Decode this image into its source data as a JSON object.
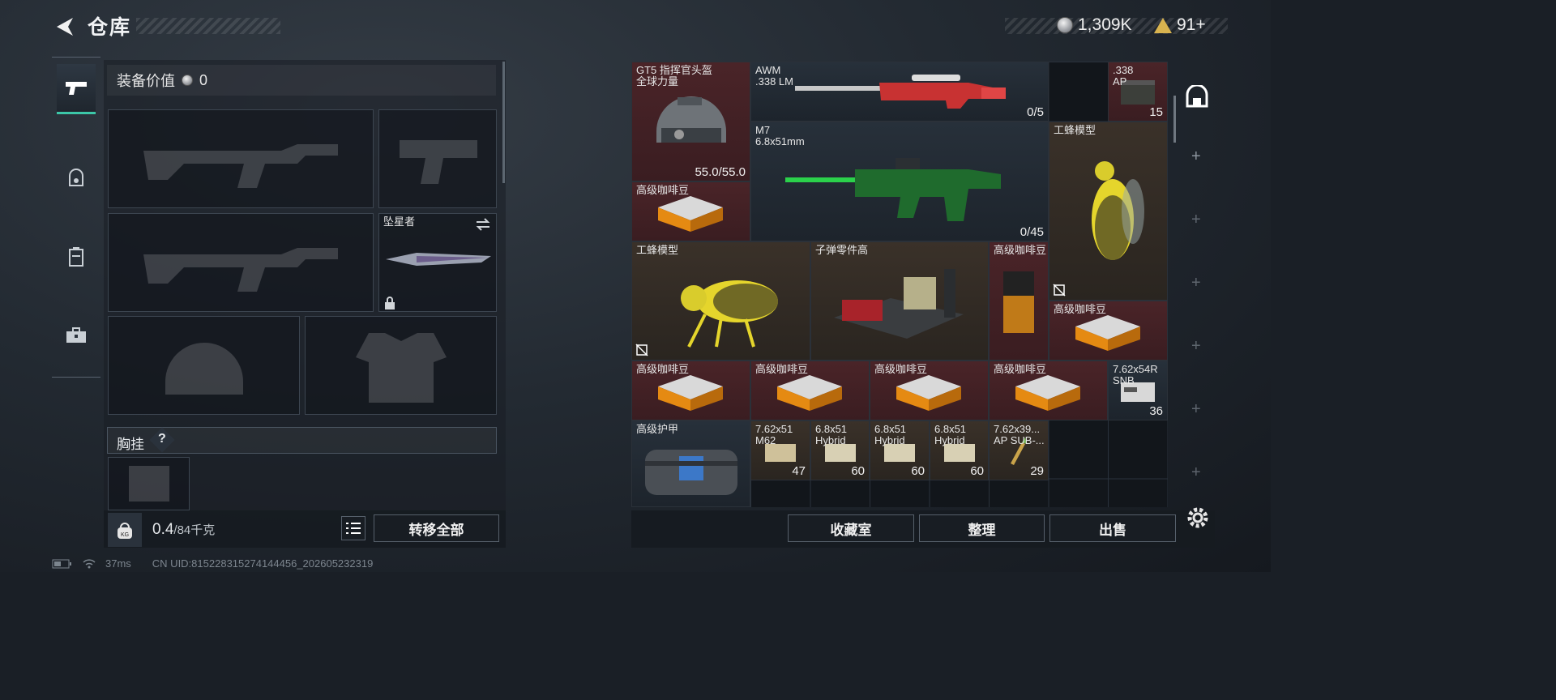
{
  "header": {
    "title": "仓库",
    "currency_a": "1,309K",
    "currency_b": "91+"
  },
  "rail": {
    "tabs": [
      {
        "name": "weapons",
        "icon": "pistol-icon"
      },
      {
        "name": "helmet",
        "icon": "helmet-icon"
      },
      {
        "name": "vest",
        "icon": "vest-icon"
      },
      {
        "name": "case",
        "icon": "case-icon"
      }
    ]
  },
  "equip": {
    "label": "装备价值",
    "value": "0",
    "melee_name": "坠星者",
    "chest_label": "胸挂",
    "chest_help": "?"
  },
  "footer_left": {
    "weight": "0.4",
    "weight_unit": "/84千克",
    "transfer_all": "转移全部"
  },
  "items": [
    {
      "name": "GT5 指挥官头盔\n全球力量",
      "qty": "55.0/55.0",
      "bg": "red",
      "icon": "helmet-icon"
    },
    {
      "name": "AWM\n.338 LM",
      "qty": "0/5",
      "bg": "dark",
      "icon": "sniper-rifle-icon"
    },
    {
      "name": ".338\nAP",
      "qty": "15",
      "bg": "red",
      "icon": "ammo-box-icon"
    },
    {
      "name": "M7\n6.8x51mm",
      "qty": "0/45",
      "bg": "dark",
      "icon": "rifle-icon"
    },
    {
      "name": "工蜂模型",
      "qty": "",
      "bg": "brown",
      "icon": "bee-model-icon"
    },
    {
      "name": "高级咖啡豆",
      "qty": "",
      "bg": "red",
      "icon": "coffee-box-icon"
    },
    {
      "name": "工蜂模型",
      "qty": "",
      "bg": "brown",
      "icon": "bee-model-icon"
    },
    {
      "name": "子弹零件高",
      "qty": "",
      "bg": "brown",
      "icon": "bullet-parts-icon"
    },
    {
      "name": "高级咖啡豆",
      "qty": "",
      "bg": "red",
      "icon": "coffee-bag-icon"
    },
    {
      "name": "高级咖啡豆",
      "qty": "",
      "bg": "red",
      "icon": "coffee-box-icon"
    },
    {
      "name": "高级咖啡豆",
      "qty": "",
      "bg": "red",
      "icon": "coffee-box-icon"
    },
    {
      "name": "高级咖啡豆",
      "qty": "",
      "bg": "red",
      "icon": "coffee-box-icon"
    },
    {
      "name": "高级咖啡豆",
      "qty": "",
      "bg": "red",
      "icon": "coffee-box-icon"
    },
    {
      "name": "高级咖啡豆",
      "qty": "",
      "bg": "red",
      "icon": "coffee-box-icon"
    },
    {
      "name": "7.62x54R\nSNB",
      "qty": "36",
      "bg": "dark",
      "icon": "ammo-box-icon"
    },
    {
      "name": "高级护甲",
      "qty": "",
      "bg": "dark",
      "icon": "armor-bag-icon"
    },
    {
      "name": "7.62x51\nM62",
      "qty": "47",
      "bg": "brown",
      "icon": "ammo-box-icon"
    },
    {
      "name": "6.8x51\nHybrid",
      "qty": "60",
      "bg": "brown",
      "icon": "ammo-box-icon"
    },
    {
      "name": "6.8x51\nHybrid",
      "qty": "60",
      "bg": "brown",
      "icon": "ammo-box-icon"
    },
    {
      "name": "6.8x51\nHybrid",
      "qty": "60",
      "bg": "brown",
      "icon": "ammo-box-icon"
    },
    {
      "name": "7.62x39...\nAP SUB-...",
      "qty": "29",
      "bg": "brown",
      "icon": "ammo-rounds-icon"
    }
  ],
  "footer_right": {
    "collection": "收藏室",
    "sort": "整理",
    "sell": "出售"
  },
  "status": {
    "ping": "37ms",
    "uid": "CN UID:815228315274144456_202605232319"
  }
}
